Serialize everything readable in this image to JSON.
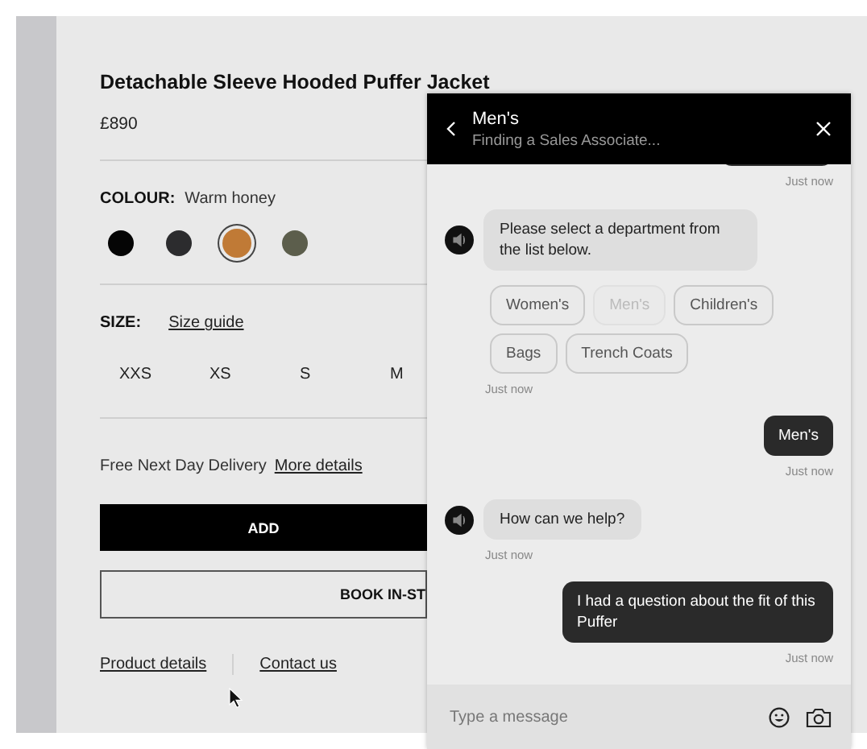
{
  "product": {
    "title": "Detachable Sleeve Hooded Puffer Jacket",
    "price": "£890",
    "colour": {
      "label": "COLOUR:",
      "value": "Warm honey",
      "swatches": [
        {
          "color": "#050505",
          "selected": false
        },
        {
          "color": "#2c2c2e",
          "selected": false
        },
        {
          "color": "#c07a36",
          "selected": true
        },
        {
          "color": "#5c5e4c",
          "selected": false
        }
      ]
    },
    "size": {
      "label": "SIZE:",
      "guide": "Size guide",
      "options": [
        "XXS",
        "XS",
        "S",
        "M"
      ]
    },
    "delivery": {
      "text": "Free Next Day Delivery",
      "link": "More details"
    },
    "add_button": "ADD",
    "book_button": "BOOK IN-ST",
    "links": [
      "Product details",
      "Contact us"
    ]
  },
  "chat": {
    "title": "Men's",
    "subtitle": "Finding a Sales Associate...",
    "messages": [
      {
        "kind": "user_cut",
        "time": "Just now"
      },
      {
        "kind": "bot",
        "text": "Please select a department from the list below.",
        "options": [
          {
            "label": "Women's",
            "disabled": false
          },
          {
            "label": "Men's",
            "disabled": true
          },
          {
            "label": "Children's",
            "disabled": false
          },
          {
            "label": "Bags",
            "disabled": false
          },
          {
            "label": "Trench Coats",
            "disabled": false
          }
        ],
        "time": "Just now"
      },
      {
        "kind": "user",
        "text": "Men's",
        "time": "Just now"
      },
      {
        "kind": "bot",
        "text": "How can we help?",
        "time": "Just now"
      },
      {
        "kind": "user",
        "text": "I had a question about the fit of this Puffer",
        "time": "Just now"
      }
    ],
    "input": {
      "placeholder": "Type a message"
    }
  }
}
